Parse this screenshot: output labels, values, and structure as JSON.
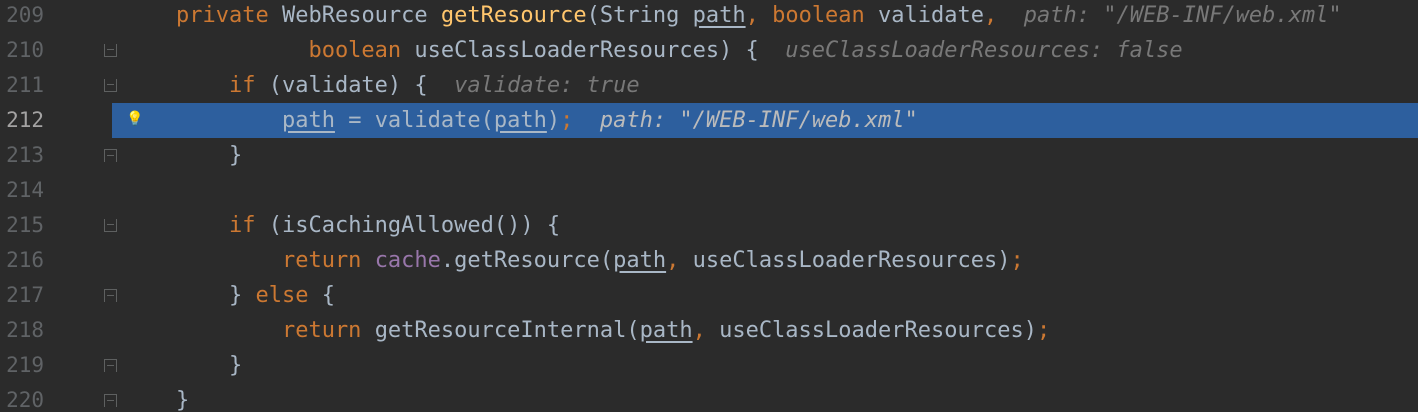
{
  "editor": {
    "lines": [
      {
        "num": "209",
        "tokens": [
          {
            "t": "private ",
            "c": "kw"
          },
          {
            "t": "WebResource ",
            "c": "plain"
          },
          {
            "t": "getResource",
            "c": "fn"
          },
          {
            "t": "(String ",
            "c": "plain"
          },
          {
            "t": "path",
            "c": "param"
          },
          {
            "t": ", ",
            "c": "kw"
          },
          {
            "t": "boolean ",
            "c": "kw"
          },
          {
            "t": "validate",
            "c": "plain"
          },
          {
            "t": ",  ",
            "c": "kw"
          },
          {
            "t": "path: \"/WEB-INF/web.xml\"",
            "c": "hint"
          }
        ]
      },
      {
        "num": "210",
        "fold": "open",
        "tokens": [
          {
            "t": "          boolean ",
            "c": "kw"
          },
          {
            "t": "useClassLoaderResources) {  ",
            "c": "plain"
          },
          {
            "t": "useClassLoaderResources: false",
            "c": "hint"
          }
        ]
      },
      {
        "num": "211",
        "fold": "open",
        "tokens": [
          {
            "t": "    if ",
            "c": "kw"
          },
          {
            "t": "(validate) {  ",
            "c": "plain"
          },
          {
            "t": "validate: true",
            "c": "hint"
          }
        ]
      },
      {
        "num": "212",
        "current": true,
        "bulb": true,
        "tokens": [
          {
            "t": "        ",
            "c": "plain"
          },
          {
            "t": "path",
            "c": "param"
          },
          {
            "t": " = validate(",
            "c": "plain"
          },
          {
            "t": "path",
            "c": "param"
          },
          {
            "t": ")",
            "c": "plain"
          },
          {
            "t": ";  ",
            "c": "kw"
          },
          {
            "t": "path: \"/WEB-INF/web.xml\"",
            "c": "hint"
          }
        ]
      },
      {
        "num": "213",
        "fold": "close",
        "tokens": [
          {
            "t": "    }",
            "c": "plain"
          }
        ]
      },
      {
        "num": "214",
        "tokens": []
      },
      {
        "num": "215",
        "fold": "open",
        "tokens": [
          {
            "t": "    if ",
            "c": "kw"
          },
          {
            "t": "(isCachingAllowed()) {",
            "c": "plain"
          }
        ]
      },
      {
        "num": "216",
        "tokens": [
          {
            "t": "        return ",
            "c": "kw"
          },
          {
            "t": "cache",
            "c": "fld"
          },
          {
            "t": ".getResource(",
            "c": "plain"
          },
          {
            "t": "path",
            "c": "param"
          },
          {
            "t": ", ",
            "c": "kw"
          },
          {
            "t": "useClassLoaderResources)",
            "c": "plain"
          },
          {
            "t": ";",
            "c": "kw"
          }
        ]
      },
      {
        "num": "217",
        "fold": "close",
        "tokens": [
          {
            "t": "    } ",
            "c": "plain"
          },
          {
            "t": "else ",
            "c": "kw"
          },
          {
            "t": "{",
            "c": "plain"
          }
        ]
      },
      {
        "num": "218",
        "tokens": [
          {
            "t": "        return ",
            "c": "kw"
          },
          {
            "t": "getResourceInternal(",
            "c": "plain"
          },
          {
            "t": "path",
            "c": "param"
          },
          {
            "t": ", ",
            "c": "kw"
          },
          {
            "t": "useClassLoaderResources)",
            "c": "plain"
          },
          {
            "t": ";",
            "c": "kw"
          }
        ]
      },
      {
        "num": "219",
        "fold": "close",
        "tokens": [
          {
            "t": "    }",
            "c": "plain"
          }
        ]
      },
      {
        "num": "220",
        "fold": "close",
        "tokens": [
          {
            "t": "}",
            "c": "plain"
          }
        ]
      }
    ]
  },
  "colors": {
    "background": "#2b2b2b",
    "keyword": "#cc7832",
    "method": "#ffc66d",
    "field": "#9876aa",
    "text": "#a9b7c6",
    "hint": "#787878",
    "current_line_highlight": "#2d5f9e",
    "line_number": "#606366"
  },
  "icons": {
    "intention_bulb": "lightbulb-icon",
    "fold_marker": "fold-marker-icon"
  },
  "glyphs": {
    "bulb": "💡"
  }
}
